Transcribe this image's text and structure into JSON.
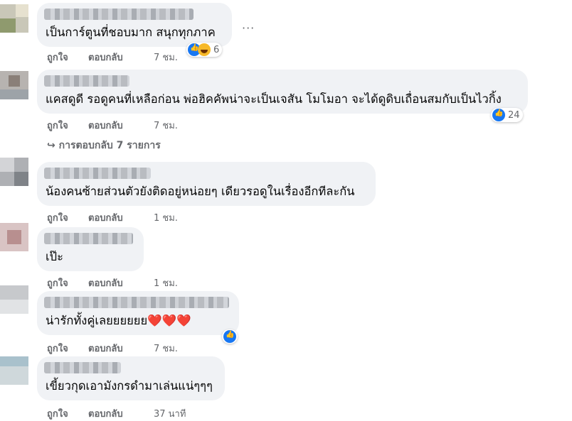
{
  "actions": {
    "like": "ถูกใจ",
    "reply": "ตอบกลับ"
  },
  "comments": [
    {
      "text": "เป็นการ์ตูนที่ชอบมาก สนุกทุกภาค",
      "time": "7 ชม.",
      "reaction_count": "6",
      "reactions": [
        "like-icon",
        "haha-icon"
      ]
    },
    {
      "text": "แคสดูดี รอดูคนที่เหลือก่อน พ่อฮิคคัพน่าจะเป็นเจสัน โมโมอา จะได้ดูดิบเถื่อนสมกับเป็นไวกิ้ง",
      "time": "7 ชม.",
      "reaction_count": "24",
      "reactions": [
        "like-icon"
      ]
    },
    {
      "text": "น้องคนซ้ายส่วนตัวยังติดอยู่หน่อยๆ เดียวรอดูในเรื่องอีกทีละกัน",
      "time": "1 ชม."
    },
    {
      "text": "เป๊ะ",
      "time": "1 ชม."
    },
    {
      "text": "น่ารักทั้งคู่เลยยยยยย",
      "hearts": "❤️❤️❤️",
      "time": "7 ชม.",
      "reactions": [
        "like-icon"
      ]
    },
    {
      "text": "เขี้ยวกุดเอามังกรดำมาเล่นแน่ๆๆๆ",
      "time": "37 นาที"
    }
  ],
  "view_replies": "↪ การตอบกลับ 7 รายการ",
  "more_options": "···",
  "colors": {
    "like_blue": "#1877f2",
    "bubble_bg": "#f0f2f5",
    "meta_gray": "#65676b",
    "heart_red": "#e41e3f"
  }
}
